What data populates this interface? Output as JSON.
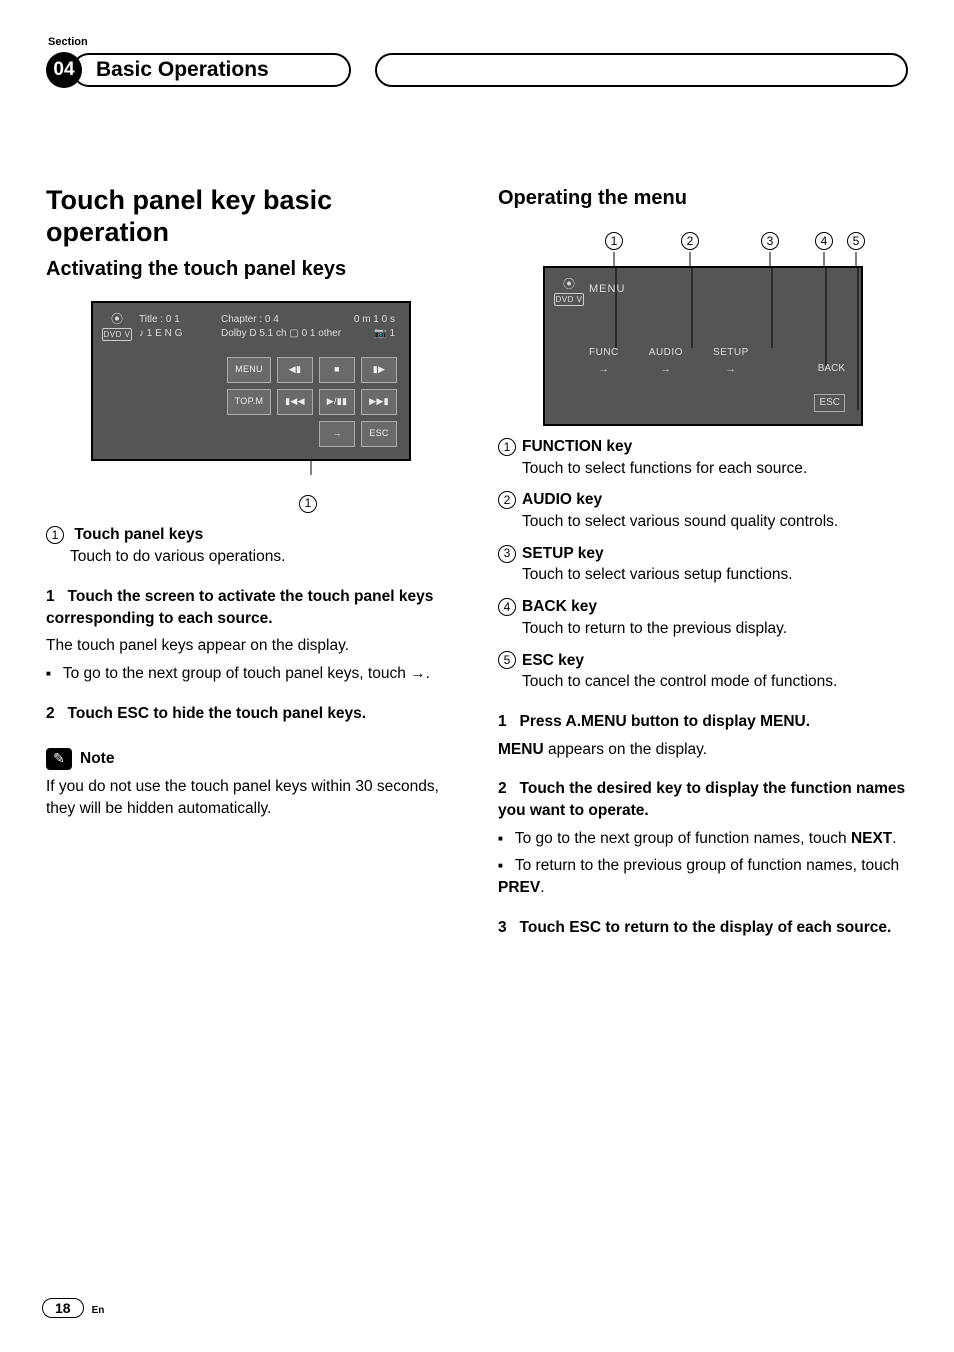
{
  "header": {
    "section_label": "Section",
    "section_number": "04",
    "chapter_title": "Basic Operations"
  },
  "left": {
    "h1": "Touch panel key basic operation",
    "h2": "Activating the touch panel keys",
    "screenshot1": {
      "title_lbl": "Title : 0 1",
      "chapter_lbl": "Chapter : 0 4",
      "time_lbl": "0 m 1 0 s",
      "line2a": "♪ 1 E N G",
      "line2b": "Dolby D 5.1 ch ▢ 0 1 other",
      "angle": "1",
      "dvd": "DVD V",
      "buttons": [
        "MENU",
        "◀▮",
        "■",
        "▮▶",
        "TOP.M",
        "▮◀◀",
        "▶/▮▮",
        "▶▶▮",
        "",
        "",
        "→",
        "ESC"
      ]
    },
    "callout1_num": "1",
    "item1": {
      "num": "1",
      "title": "Touch panel keys",
      "body": "Touch to do various operations."
    },
    "step1": {
      "num": "1",
      "title": "Touch the screen to activate the touch panel keys corresponding to each source.",
      "body": "The touch panel keys appear on the display.",
      "bullet": "To go to the next group of touch panel keys, touch ",
      "bullet_tail": "."
    },
    "step2": {
      "num": "2",
      "title": "Touch ESC to hide the touch panel keys."
    },
    "note_label": "Note",
    "note_body": "If you do not use the touch panel keys within 30 seconds, they will be hidden automatically."
  },
  "right": {
    "h2": "Operating the menu",
    "markers": [
      "1",
      "2",
      "3",
      "4",
      "5"
    ],
    "screenshot2": {
      "menu": "MENU",
      "dvd": "DVD V",
      "btns": [
        "FUNC",
        "AUDIO",
        "SETUP"
      ],
      "back": "BACK",
      "esc": "ESC"
    },
    "items": [
      {
        "num": "1",
        "title": "FUNCTION key",
        "body": "Touch to select functions for each source."
      },
      {
        "num": "2",
        "title": "AUDIO key",
        "body": "Touch to select various sound quality controls."
      },
      {
        "num": "3",
        "title": "SETUP key",
        "body": "Touch to select various setup functions."
      },
      {
        "num": "4",
        "title": "BACK key",
        "body": "Touch to return to the previous display."
      },
      {
        "num": "5",
        "title": "ESC key",
        "body": "Touch to cancel the control mode of functions."
      }
    ],
    "step1": {
      "num": "1",
      "title": "Press A.MENU button to display MENU.",
      "body_pre": "MENU",
      "body_post": " appears on the display."
    },
    "step2": {
      "num": "2",
      "title": "Touch the desired key to display the function names you want to operate.",
      "b1_pre": "To go to the next group of function names, touch ",
      "b1_bold": "NEXT",
      "b1_post": ".",
      "b2_pre": "To return to the previous group of function names, touch ",
      "b2_bold": "PREV",
      "b2_post": "."
    },
    "step3": {
      "num": "3",
      "title": "Touch ESC to return to the display of each source."
    }
  },
  "footer": {
    "page": "18",
    "lang": "En"
  }
}
